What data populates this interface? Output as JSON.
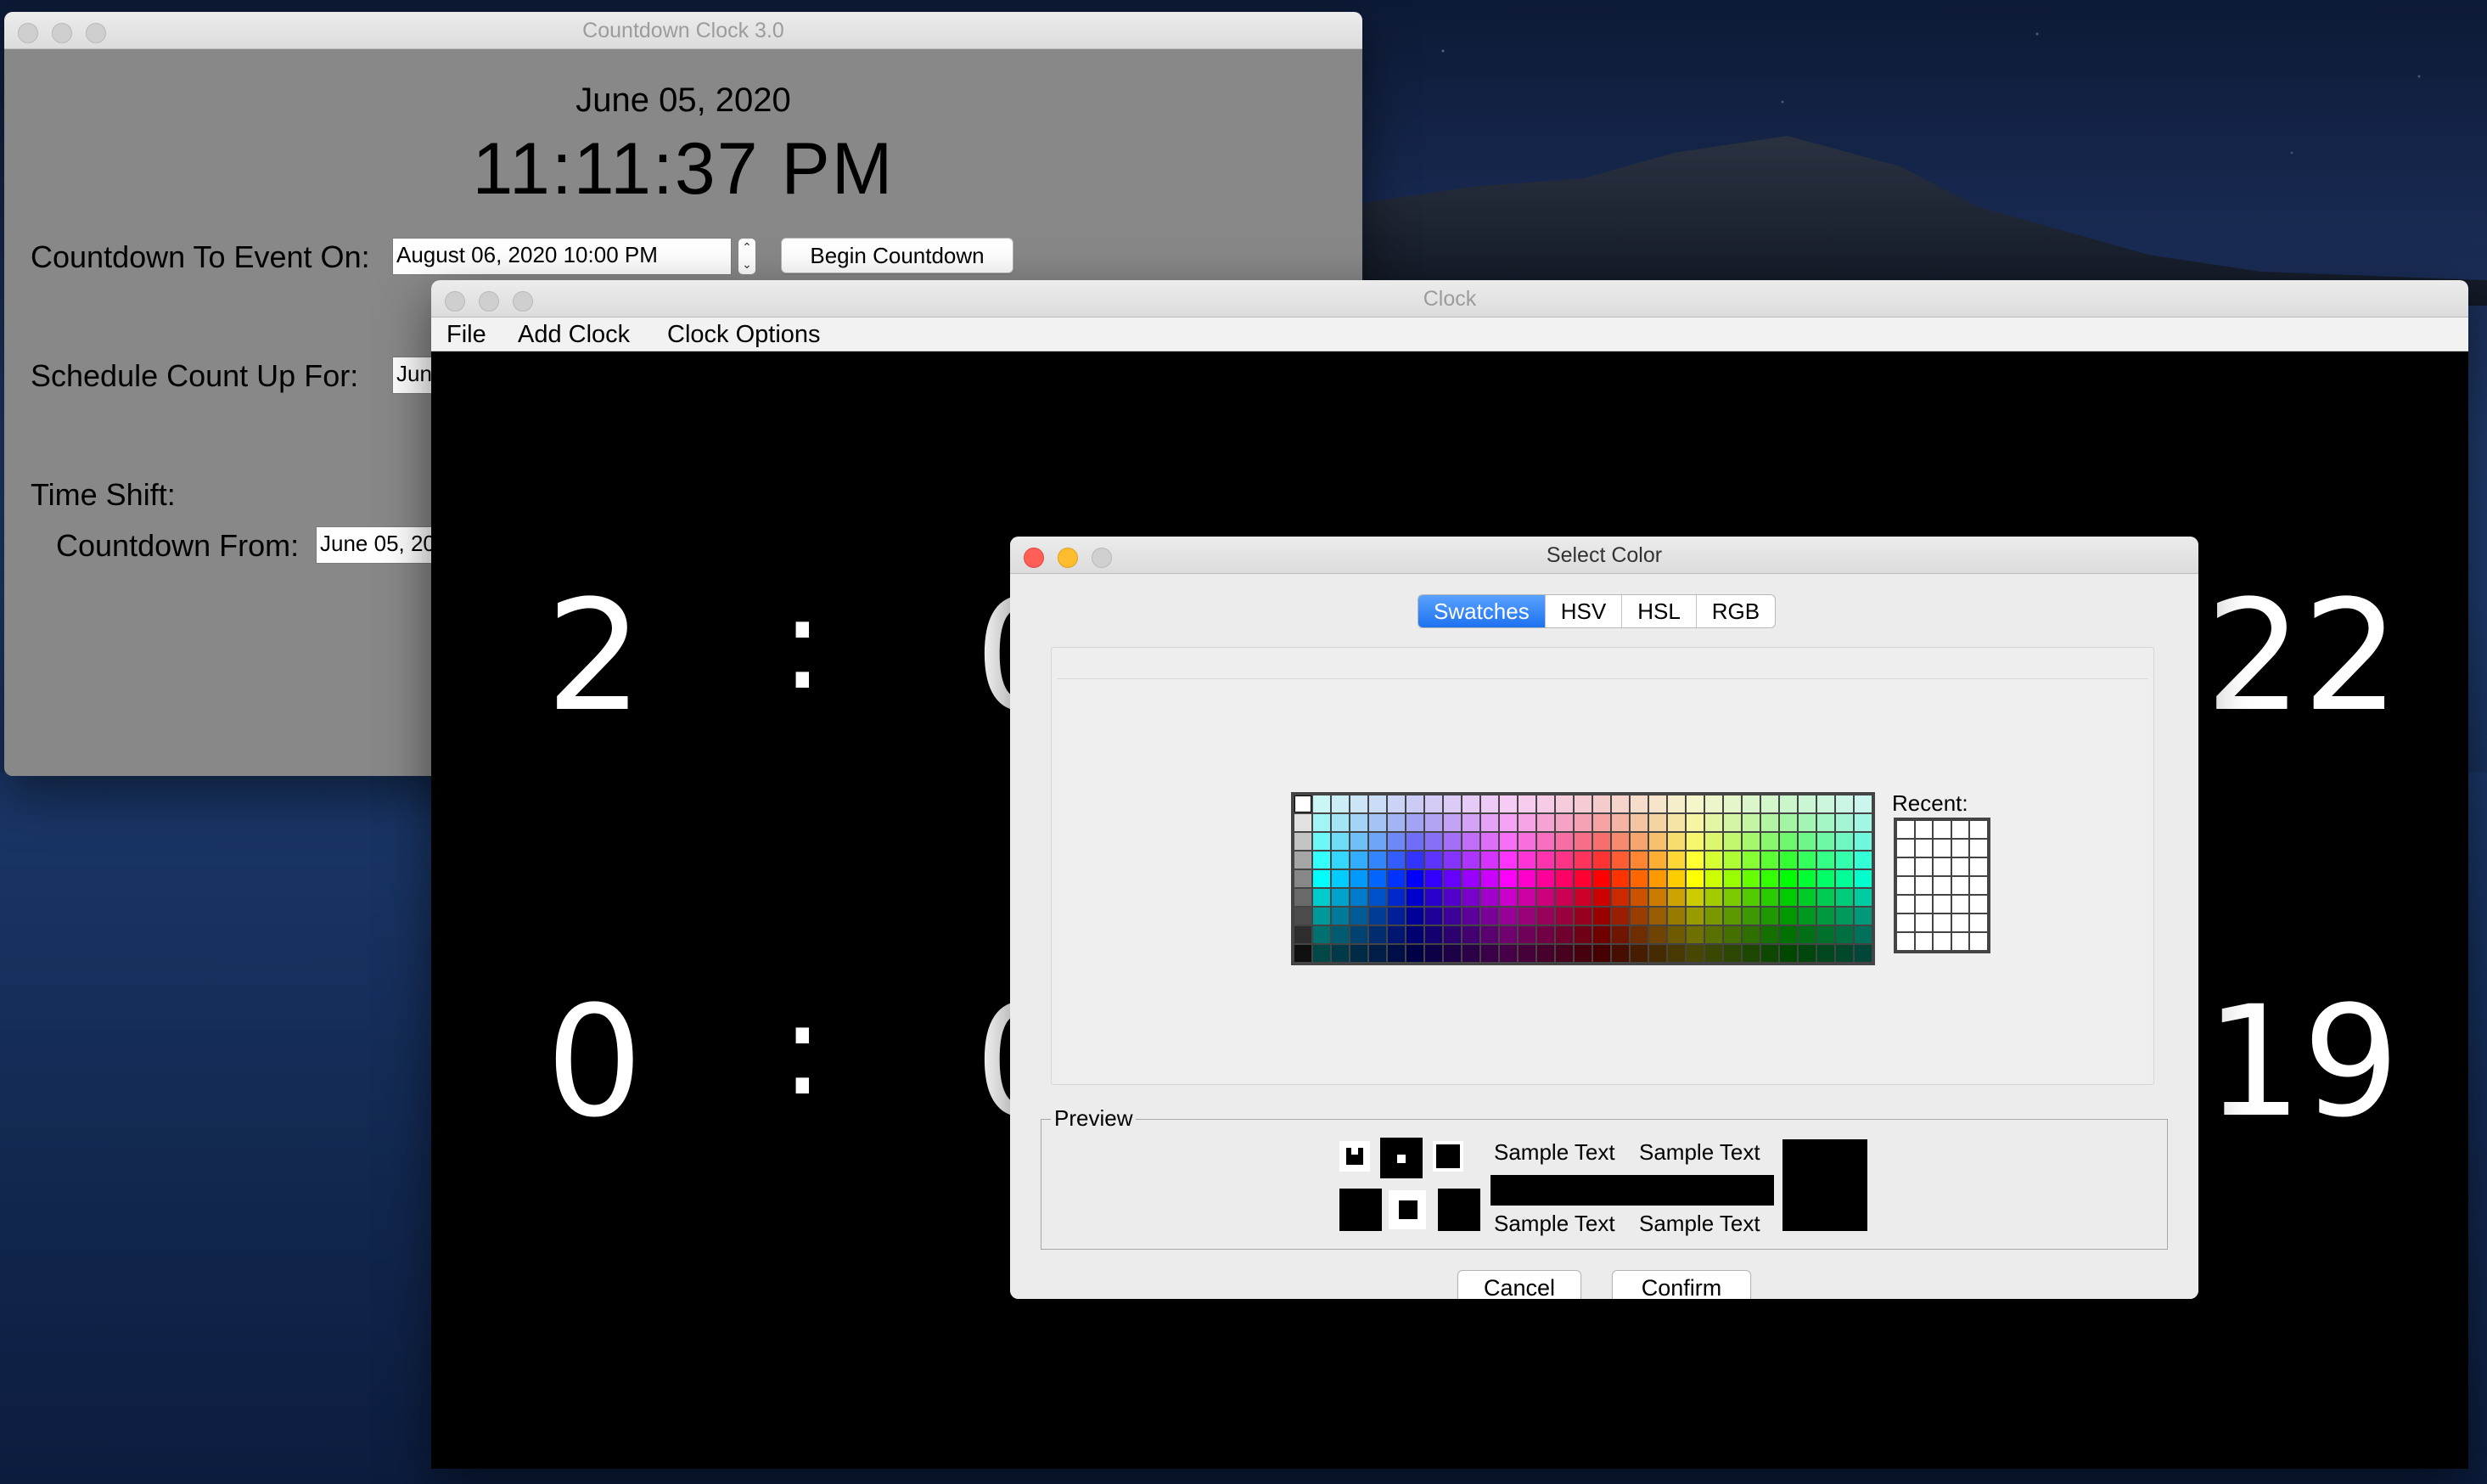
{
  "countdown_window": {
    "title": "Countdown Clock 3.0",
    "date": "June 05, 2020",
    "time": "11:11:37 PM",
    "countdown_to_label": "Countdown To Event On:",
    "event_datetime": "August 06, 2020  10:00 PM",
    "begin_button": "Begin Countdown",
    "count_up_label": "Schedule Count Up For:",
    "count_up_value": "Jun",
    "time_shift_label": "Time Shift:",
    "countdown_from_label": "Countdown From:",
    "countdown_from_value": "June 05, 20"
  },
  "clock_window": {
    "title": "Clock",
    "menu": [
      "File",
      "Add Clock",
      "Clock Options"
    ],
    "row1": {
      "left": "2",
      "colon": ":",
      "partial": "0",
      "right": "22"
    },
    "row2": {
      "left": "0",
      "colon": ":",
      "partial": "0",
      "right": "19"
    }
  },
  "color_dialog": {
    "title": "Select Color",
    "tabs": [
      "Swatches",
      "HSV",
      "HSL",
      "RGB"
    ],
    "active_tab": "Swatches",
    "recent_label": "Recent:",
    "preview_label": "Preview",
    "sample_text": "Sample Text",
    "cancel_button": "Cancel",
    "confirm_button": "Confirm",
    "selected_color": "#000000"
  }
}
